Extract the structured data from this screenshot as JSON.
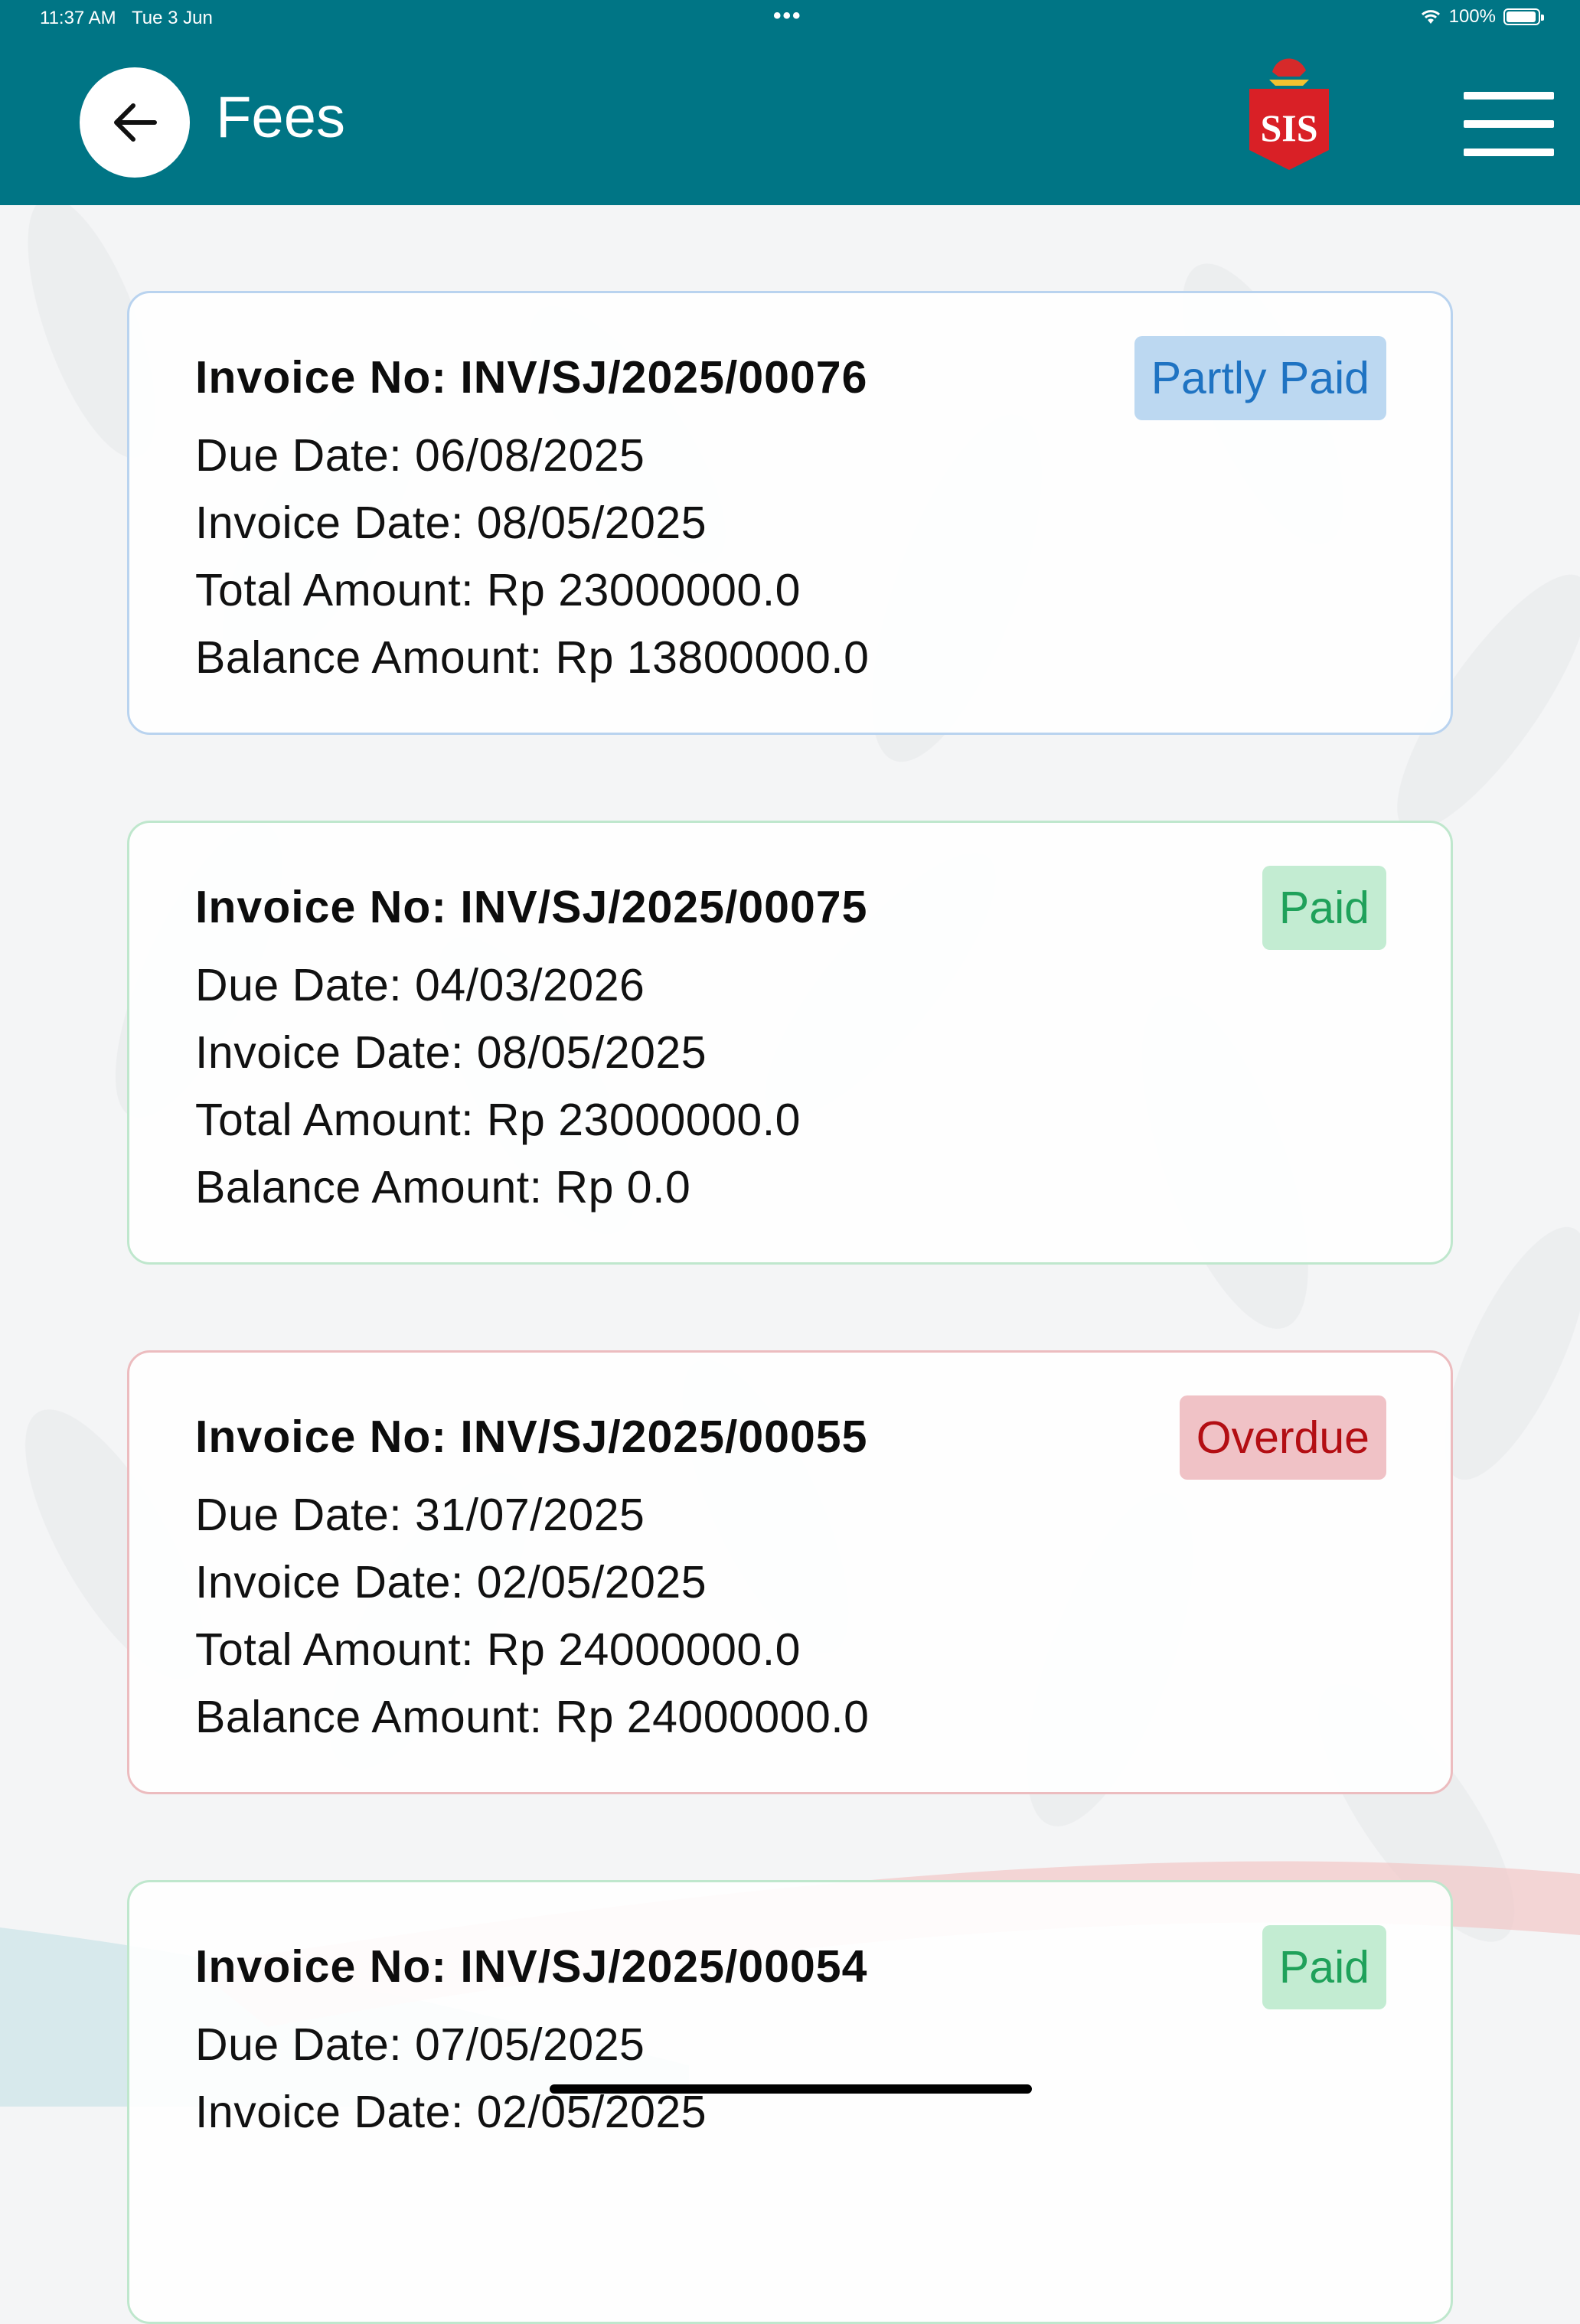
{
  "status_bar": {
    "time": "11:37 AM",
    "date": "Tue 3 Jun",
    "dots": "•••",
    "battery": "100%"
  },
  "header": {
    "title": "Fees",
    "logo_text": "SIS"
  },
  "invoices": [
    {
      "invoice_no": "Invoice No: INV/SJ/2025/00076",
      "due_date": "Due Date: 06/08/2025",
      "invoice_date": "Invoice Date: 08/05/2025",
      "total_amount": "Total Amount: Rp 23000000.0",
      "balance_amount": "Balance Amount: Rp 13800000.0",
      "status": "Partly Paid",
      "status_color": "#1f73c2"
    },
    {
      "invoice_no": "Invoice No: INV/SJ/2025/00075",
      "due_date": "Due Date: 04/03/2026",
      "invoice_date": "Invoice Date: 08/05/2025",
      "total_amount": "Total Amount: Rp 23000000.0",
      "balance_amount": "Balance Amount: Rp 0.0",
      "status": "Paid",
      "status_color": "#1fa15a"
    },
    {
      "invoice_no": "Invoice No: INV/SJ/2025/00055",
      "due_date": "Due Date: 31/07/2025",
      "invoice_date": "Invoice Date: 02/05/2025",
      "total_amount": "Total Amount: Rp 24000000.0",
      "balance_amount": "Balance Amount: Rp 24000000.0",
      "status": "Overdue",
      "status_color": "#b30e13"
    },
    {
      "invoice_no": "Invoice No: INV/SJ/2025/00054",
      "due_date": "Due Date: 07/05/2025",
      "invoice_date": "Invoice Date: 02/05/2025",
      "status": "Paid",
      "status_color": "#1fa15a"
    }
  ],
  "colors": {
    "header_bg": "#007585",
    "background": "#f4f5f6"
  }
}
